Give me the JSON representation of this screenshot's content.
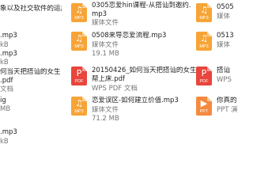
{
  "colors": {
    "mp3": "#f7a436",
    "pdf": "#e8453c",
    "ppt": "#f58a3f",
    "name_text": "#222222",
    "meta_text": "#777777"
  },
  "icons": {
    "mp3": "music-note-icon",
    "pdf": "pdf-icon",
    "ppt": "presentation-icon"
  },
  "col1": {
    "row1_name": "象以及社交软件的运用.",
    "row2_name": ".mp3",
    "row2_meta": "kB",
    "row3_name": ".mp3",
    "row3_meta": "kB",
    "row4_name_l1": "何当天把搭讪的女生",
    "row4_name_l2": ".pdf",
    "row4_meta": "文档",
    "row5_name_l1": "ig",
    "row5_name_l2": "MB",
    "row6_name_l1": ".mp3",
    "row6_meta": "kB"
  },
  "col2": {
    "item1_name_l1": "0305恋爱hin课程-从搭讪到邀约.",
    "item1_name_l2": "mp3",
    "item1_meta": "媒体文件",
    "item1_tag": "MP3",
    "item2_name": "0508来导恋爱流程.mp3",
    "item2_meta_l1": "媒体文件",
    "item2_meta_l2": "19.1 MB",
    "item2_tag": "MP3",
    "item3_name_l1": "20150426_如何当天把搭讪的女生",
    "item3_name_l2": "帮上床.pdf",
    "item3_meta": "WPS PDF 文档",
    "item3_tag": "PDF",
    "item4_name": "恋爱误区-如何建立价值.mp3",
    "item4_meta_l1": "媒体文件",
    "item4_meta_l2": "71.2 MB",
    "item4_tag": "MP3"
  },
  "col3": {
    "item1_name": "0505",
    "item1_meta": "媒体",
    "item1_tag": "MP3",
    "item2_name": "0513",
    "item2_meta_l1": "媒体",
    "item2_meta_l2": "",
    "item2_tag": "MP3",
    "item3_name": "搭讪",
    "item3_meta": "WPS",
    "item3_tag": "PDF",
    "item4_name": "你真的",
    "item4_meta": "PPT 演",
    "item4_tag": "PPT"
  }
}
